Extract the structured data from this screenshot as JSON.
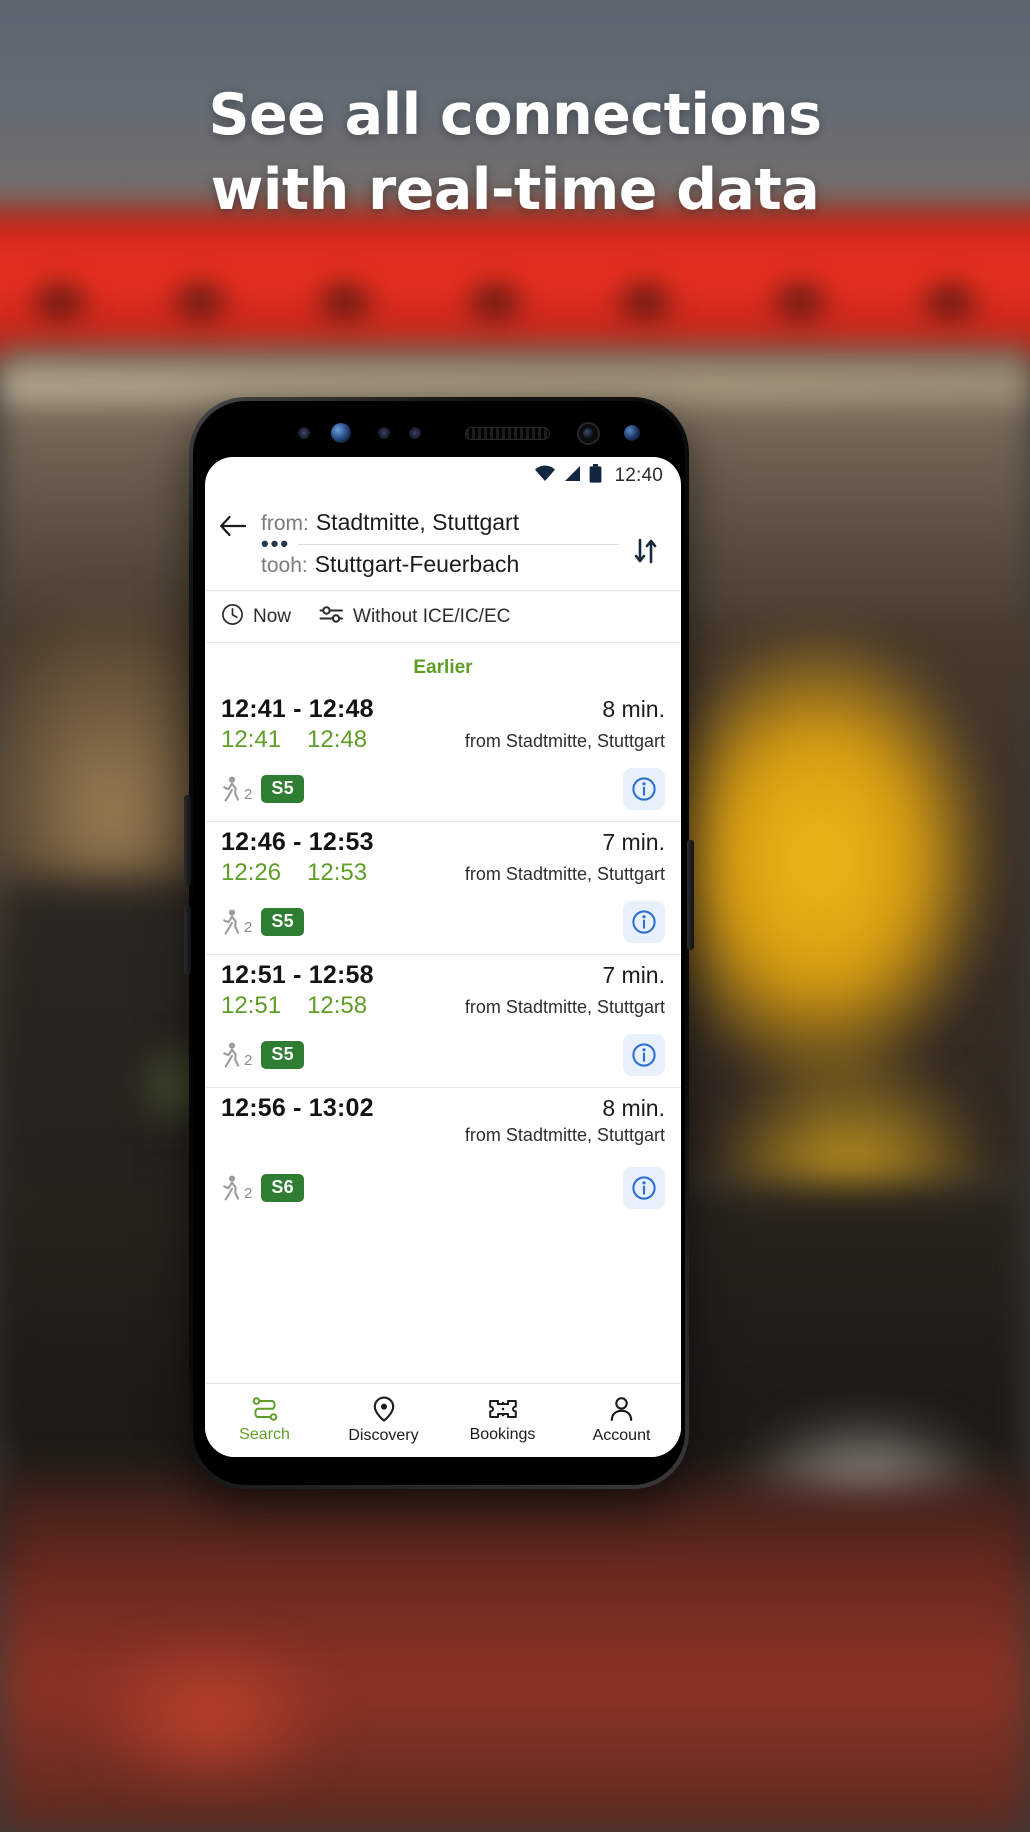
{
  "promo": {
    "headline_line1": "See all connections",
    "headline_line2": "with real-time data"
  },
  "status_bar": {
    "time": "12:40",
    "icons": [
      "wifi-icon",
      "cellular-signal-icon",
      "battery-icon"
    ]
  },
  "search_header": {
    "back_icon": "back-arrow-icon",
    "swap_icon": "swap-vertical-icon",
    "origin_label": "from:",
    "origin_value": "Stadtmitte, Stuttgart",
    "destination_label": "tooh:",
    "destination_value": "Stuttgart-Feuerbach"
  },
  "filter_bar": {
    "time_icon": "clock-icon",
    "time_label": "Now",
    "filter_icon": "sliders-icon",
    "filter_label": "Without ICE/IC/EC"
  },
  "results": {
    "earlier_label": "Earlier",
    "connections": [
      {
        "times": "12:41 - 12:48",
        "duration": "8 min.",
        "realtime_departure": "12:41",
        "realtime_arrival": "12:48",
        "from_text": "from Stadtmitte, Stuttgart",
        "walk_count": "2",
        "line": "S5",
        "info_icon": "info-icon"
      },
      {
        "times": "12:46 - 12:53",
        "duration": "7 min.",
        "realtime_departure": "12:26",
        "realtime_arrival": "12:53",
        "from_text": "from Stadtmitte, Stuttgart",
        "walk_count": "2",
        "line": "S5",
        "info_icon": "info-icon"
      },
      {
        "times": "12:51 - 12:58",
        "duration": "7 min.",
        "realtime_departure": "12:51",
        "realtime_arrival": "12:58",
        "from_text": "from Stadtmitte, Stuttgart",
        "walk_count": "2",
        "line": "S5",
        "info_icon": "info-icon"
      },
      {
        "times": "12:56 - 13:02",
        "duration": "8 min.",
        "realtime_departure": "",
        "realtime_arrival": "",
        "from_text": "from Stadtmitte, Stuttgart",
        "walk_count": "2",
        "line": "S6",
        "info_icon": "info-icon"
      }
    ]
  },
  "bottom_nav": {
    "items": [
      {
        "label": "Search",
        "icon": "route-icon",
        "active": true
      },
      {
        "label": "Discovery",
        "icon": "map-pin-icon",
        "active": false
      },
      {
        "label": "Bookings",
        "icon": "ticket-icon",
        "active": false
      },
      {
        "label": "Account",
        "icon": "person-icon",
        "active": false
      }
    ]
  },
  "colors": {
    "accent_green": "#5f9e26",
    "line_badge_green": "#2e7d32",
    "info_blue": "#2f6fd0",
    "info_blue_bg": "#e8f1fb"
  }
}
